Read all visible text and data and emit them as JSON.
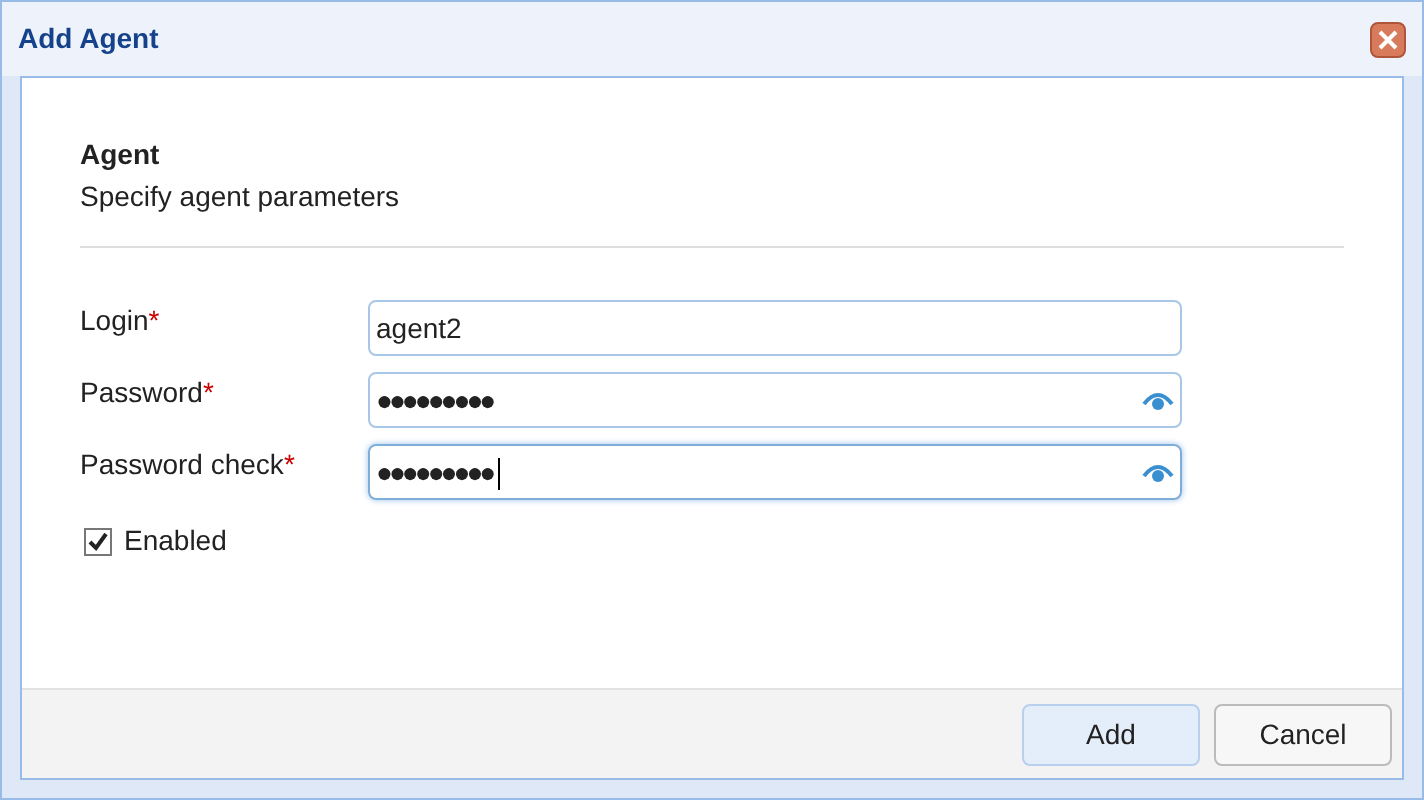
{
  "window": {
    "title": "Add Agent"
  },
  "section": {
    "title": "Agent",
    "subtitle": "Specify agent parameters"
  },
  "fields": [
    {
      "label": "Login",
      "required_mark": "*",
      "value": "agent2",
      "kind": "text",
      "focused": false
    },
    {
      "label": "Password",
      "required_mark": "*",
      "value": "●●●●●●●●●",
      "kind": "password",
      "focused": false
    },
    {
      "label": "Password check",
      "required_mark": "*",
      "value": "●●●●●●●●●",
      "kind": "password",
      "focused": true
    }
  ],
  "enabled": {
    "label": "Enabled",
    "checked": true
  },
  "buttons": [
    {
      "label": "Add",
      "selected": true
    },
    {
      "label": "Cancel",
      "selected": false
    }
  ]
}
